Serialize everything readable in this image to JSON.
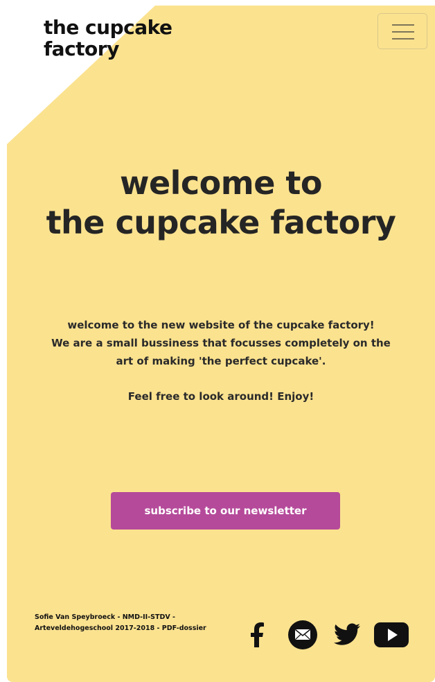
{
  "header": {
    "logo_line1": "the cupcake",
    "logo_line2": "factory",
    "menu_icon": "hamburger-menu-icon"
  },
  "hero": {
    "title_line1": "welcome to",
    "title_line2": "the cupcake factory"
  },
  "intro": {
    "line1": "welcome to the new website of the cupcake factory!",
    "line2": "We are a small bussiness that focusses completely on the",
    "line3": "art of making 'the perfect cupcake'.",
    "line4": "Feel free to look around! Enjoy!"
  },
  "cta": {
    "subscribe_label": "subscribe to our newsletter"
  },
  "footer": {
    "credit_line1": "Sofie Van Speybroeck - NMD-II-STDV -",
    "credit_line2": "Arteveldehogeschool 2017-2018 - PDF-dossier",
    "social_icons": [
      "facebook-icon",
      "mail-icon",
      "twitter-icon",
      "youtube-icon"
    ]
  },
  "colors": {
    "background": "#fbe28f",
    "accent": "#b54a9a",
    "text": "#252525"
  }
}
